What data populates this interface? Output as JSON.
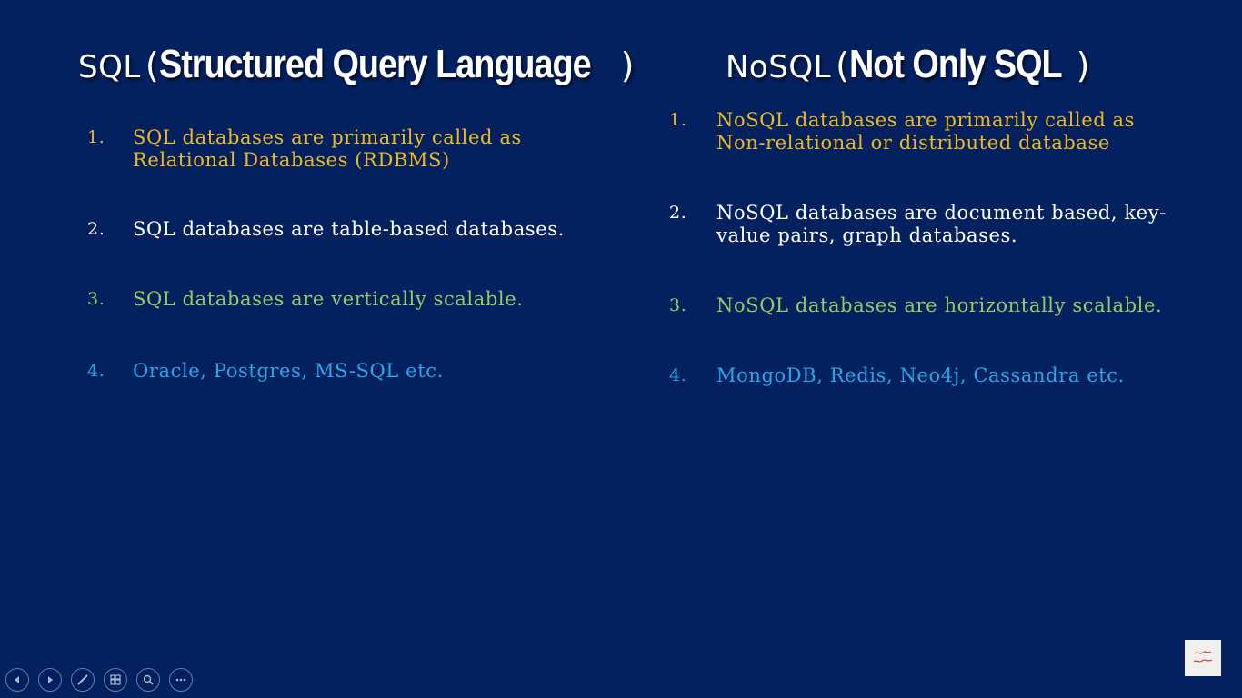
{
  "left": {
    "title_small": "SQL",
    "title_paren_open": "(",
    "title_big": "Structured Query Language",
    "title_paren_close": ")",
    "items": [
      {
        "num": "1.",
        "text": "SQL databases are primarily called as Relational Databases (RDBMS)",
        "color": "#f0b81f"
      },
      {
        "num": "2.",
        "text": "SQL databases are table-based databases.",
        "color": "#ffffff"
      },
      {
        "num": "3.",
        "text": "SQL databases are vertically scalable.",
        "color": "#8fcf62"
      },
      {
        "num": "4.",
        "text": "Oracle, Postgres, MS-SQL etc.",
        "color": "#2aa5e8"
      }
    ]
  },
  "right": {
    "title_small": "NoSQL",
    "title_paren_open": "(",
    "title_big": "Not Only SQL",
    "title_paren_close": ")",
    "items": [
      {
        "num": "1.",
        "text": "NoSQL databases are primarily called as Non-relational or distributed database",
        "color": "#f0b81f"
      },
      {
        "num": "2.",
        "text": "NoSQL databases are document based, key-value pairs, graph databases.",
        "color": "#ffffff"
      },
      {
        "num": "3.",
        "text": "NoSQL databases are horizontally scalable.",
        "color": "#8fcf62"
      },
      {
        "num": "4.",
        "text": "MongoDB, Redis, Neo4j, Cassandra etc.",
        "color": "#2aa5e8"
      }
    ]
  },
  "toolbar": {
    "icons": [
      "previous-icon",
      "next-icon",
      "pen-icon",
      "slides-icon",
      "zoom-icon",
      "more-icon"
    ]
  },
  "colors": {
    "background": "#03215f",
    "yellow": "#f0b81f",
    "white": "#ffffff",
    "green": "#8fcf62",
    "blue": "#2aa5e8"
  }
}
